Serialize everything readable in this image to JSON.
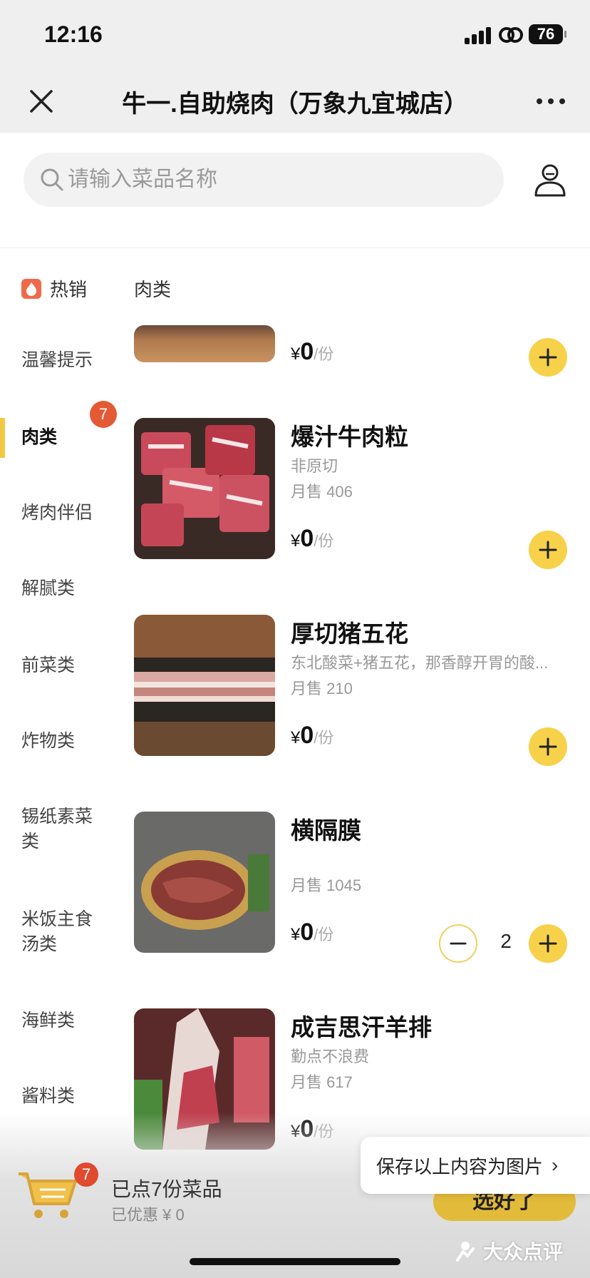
{
  "status_bar": {
    "time": "12:16",
    "battery": "76"
  },
  "nav": {
    "title": "牛一.自助烧肉（万象九宜城店）"
  },
  "search": {
    "placeholder": "请输入菜品名称"
  },
  "top_tabs": {
    "hot": "热销",
    "meat": "肉类"
  },
  "sidebar": {
    "items": [
      "温馨提示",
      "肉类",
      "烤肉伴侣",
      "解腻类",
      "前菜类",
      "炸物类",
      "锡纸素菜类",
      "米饭主食汤类",
      "海鲜类",
      "酱料类"
    ],
    "active_badge": "7"
  },
  "dishes": [
    {
      "name": "",
      "desc": "",
      "sales": "",
      "price": "0",
      "unit": "/份",
      "currency": "¥"
    },
    {
      "name": "爆汁牛肉粒",
      "desc": "非原切",
      "sales": "月售 406",
      "price": "0",
      "unit": "/份",
      "currency": "¥"
    },
    {
      "name": "厚切猪五花",
      "desc": "东北酸菜+猪五花，那香醇开胃的酸...",
      "sales": "月售 210",
      "price": "0",
      "unit": "/份",
      "currency": "¥"
    },
    {
      "name": "横隔膜",
      "desc": "",
      "sales": "月售 1045",
      "price": "0",
      "unit": "/份",
      "currency": "¥",
      "quantity": "2"
    },
    {
      "name": "成吉思汗羊排",
      "desc": "勤点不浪费",
      "sales": "月售 617",
      "price": "0",
      "unit": "/份",
      "currency": "¥"
    }
  ],
  "cart": {
    "badge": "7",
    "count_text": "已点7份菜品",
    "discount_text": "已优惠 ¥ 0",
    "checkout": "选好了"
  },
  "save_tip": {
    "label": "保存以上内容为图片",
    "chevron": "›"
  },
  "watermark": {
    "text": "大众点评"
  },
  "colors": {
    "accent": "#f7d14a",
    "badge": "#e35a34",
    "nav_bg": "#efefef"
  },
  "icons": [
    "close-icon",
    "more-icon",
    "search-icon",
    "user-icon",
    "flame-icon",
    "plus-icon",
    "minus-icon",
    "cart-icon"
  ]
}
